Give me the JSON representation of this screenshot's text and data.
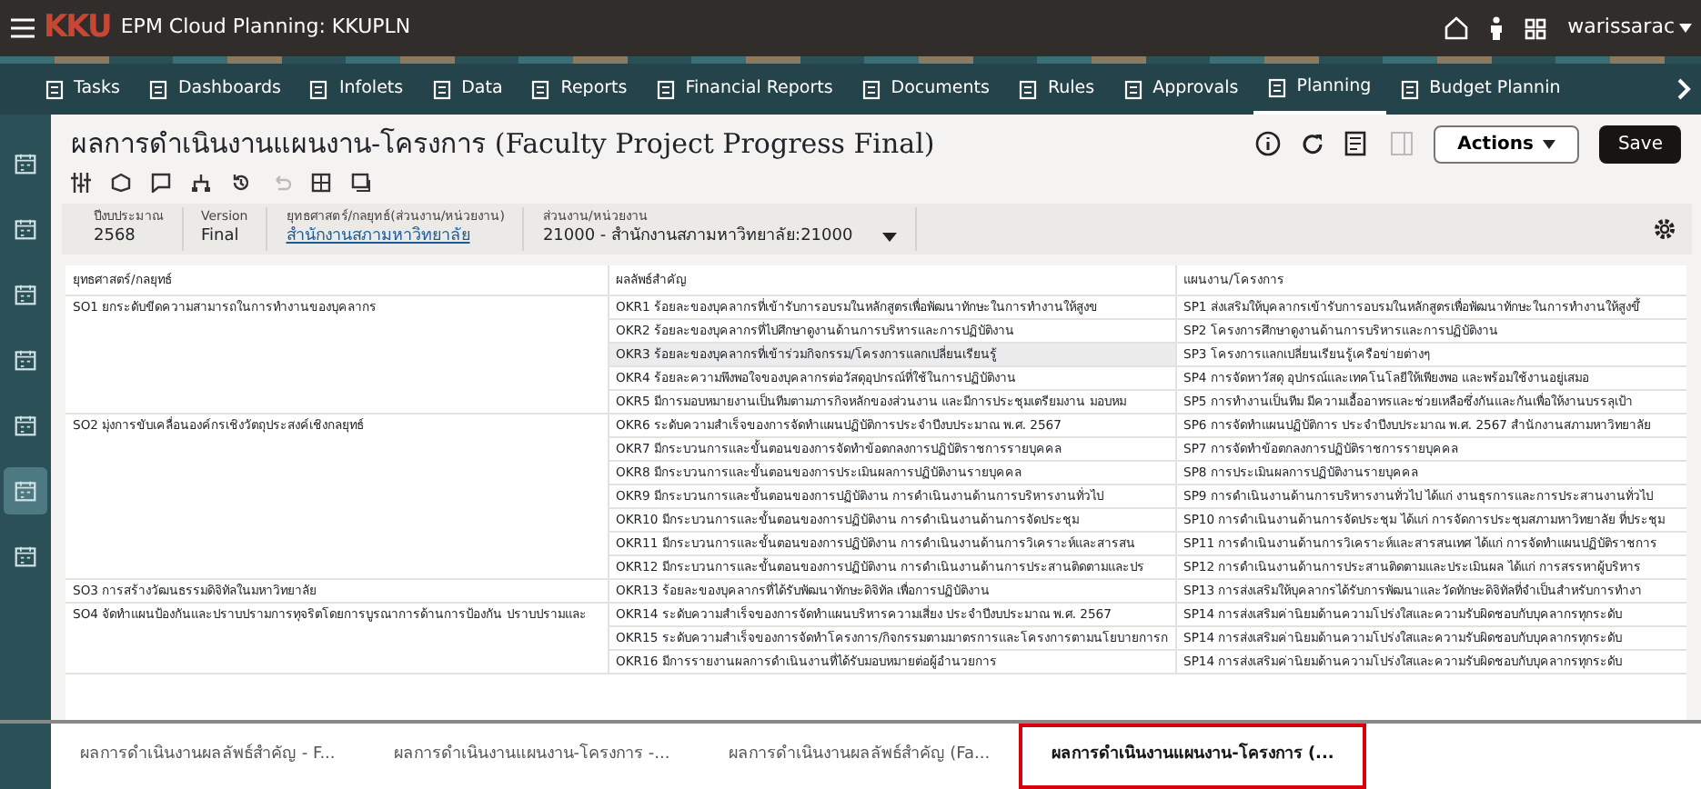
{
  "app_bar": {
    "title": "EPM Cloud Planning: KKUPLN",
    "logo": "KKU",
    "user": "warissarac"
  },
  "nav_tabs": [
    {
      "label": "Tasks",
      "selected": false
    },
    {
      "label": "Dashboards",
      "selected": false
    },
    {
      "label": "Infolets",
      "selected": false
    },
    {
      "label": "Data",
      "selected": false
    },
    {
      "label": "Reports",
      "selected": false
    },
    {
      "label": "Financial Reports",
      "selected": false
    },
    {
      "label": "Documents",
      "selected": false
    },
    {
      "label": "Rules",
      "selected": false
    },
    {
      "label": "Approvals",
      "selected": false
    },
    {
      "label": "Planning",
      "selected": true
    },
    {
      "label": "Budget Plannin",
      "selected": false
    }
  ],
  "side_rail": [
    {
      "selected": false
    },
    {
      "selected": false
    },
    {
      "selected": false
    },
    {
      "selected": false
    },
    {
      "selected": false
    },
    {
      "selected": true
    },
    {
      "selected": false
    }
  ],
  "page": {
    "title": "ผลการดำเนินงานแผนงาน-โครงการ (Faculty Project Progress Final)",
    "actions": "Actions",
    "save": "Save"
  },
  "pov": [
    {
      "kind": "text",
      "label": "ปีงบประมาณ",
      "value": "2568"
    },
    {
      "kind": "text",
      "label": "Version",
      "value": "Final"
    },
    {
      "kind": "link",
      "label": "ยุทธศาสตร์/กลยุทธ์(ส่วนงาน/หน่วยงาน)",
      "value": "สำนักงานสภามหาวิทยาลัย"
    },
    {
      "kind": "dropdown",
      "label": "ส่วนงาน/หน่วยงาน",
      "value": "21000 - สำนักงานสภามหาวิทยาลัย:21000"
    }
  ],
  "table": {
    "columns": [
      "ยุทธศาสตร์/กลยุทธ์",
      "ผลลัพธ์สำคัญ",
      "แผนงาน/โครงการ"
    ],
    "groups": [
      {
        "strategy": "SO1 ยกระดับขีดความสามารถในการทำงานของบุคลากร",
        "rows": [
          {
            "okr": "OKR1 ร้อยละของบุคลากรที่เข้ารับการอบรมในหลักสูตรเพื่อพัฒนาทักษะในการทำงานให้สูงข",
            "plan": "SP1 ส่งเสริมให้บุคลากรเข้ารับการอบรมในหลักสูตรเพื่อพัฒนาทักษะในการทำงานให้สูงขึ้",
            "highlighted": false
          },
          {
            "okr": "OKR2 ร้อยละของบุคลากรที่ไปศึกษาดูงานด้านการบริหารและการปฏิบัติงาน",
            "plan": "SP2 โครงการศึกษาดูงานด้านการบริหารและการปฏิบัติงาน",
            "highlighted": false
          },
          {
            "okr": "OKR3 ร้อยละของบุคลากรที่เข้าร่วมกิจกรรม/โครงการแลกเปลี่ยนเรียนรู้",
            "plan": "SP3 โครงการแลกเปลี่ยนเรียนรู้เครือข่ายต่างๆ",
            "highlighted": true
          },
          {
            "okr": "OKR4 ร้อยละความพึงพอใจของบุคลากรต่อวัสดุอุปกรณ์ที่ใช้ในการปฏิบัติงาน",
            "plan": "SP4 การจัดหาวัสดุ อุปกรณ์และเทคโนโลยีให้เพียงพอ และพร้อมใช้งานอยู่เสมอ",
            "highlighted": false
          },
          {
            "okr": "OKR5 มีการมอบหมายงานเป็นทีมตามภารกิจหลักของส่วนงาน และมีการประชุมเตรียมงาน มอบหม",
            "plan": "SP5 การทำงานเป็นทีม มีความเอื้ออาทรและช่วยเหลือซึ่งกันและกันเพื่อให้งานบรรลุเป้า",
            "highlighted": false
          }
        ]
      },
      {
        "strategy": "SO2 มุ่งการขับเคลื่อนองค์กรเชิงวัตถุประสงค์เชิงกลยุทธ์",
        "rows": [
          {
            "okr": "OKR6 ระดับความสำเร็จของการจัดทำแผนปฏิบัติการประจำปีงบประมาณ พ.ศ. 2567",
            "plan": "SP6 การจัดทำแผนปฏิบัติการ ประจำปีงบประมาณ พ.ศ. 2567 สำนักงานสภามหาวิทยาลัย",
            "highlighted": false
          },
          {
            "okr": "OKR7 มีกระบวนการและขั้นตอนของการจัดทำข้อตกลงการปฏิบัติราชการรายบุคคล",
            "plan": "SP7 การจัดทำข้อตกลงการปฏิบัติราชการรายบุคคล",
            "highlighted": false
          },
          {
            "okr": "OKR8 มีกระบวนการและขั้นตอนของการประเมินผลการปฏิบัติงานรายบุคคล",
            "plan": "SP8 การประเมินผลการปฏิบัติงานรายบุคคล",
            "highlighted": false
          },
          {
            "okr": "OKR9 มีกระบวนการและขั้นตอนของการปฏิบัติงาน การดำเนินงานด้านการบริหารงานทั่วไป",
            "plan": "SP9 การดำเนินงานด้านการบริหารงานทั่วไป ได้แก่ งานธุรการและการประสานงานทั่วไป",
            "highlighted": false
          },
          {
            "okr": "OKR10 มีกระบวนการและขั้นตอนของการปฏิบัติงาน การดำเนินงานด้านการจัดประชุม",
            "plan": "SP10 การดำเนินงานด้านการจัดประชุม ได้แก่ การจัดการประชุมสภามหาวิทยาลัย ที่ประชุม",
            "highlighted": false
          },
          {
            "okr": "OKR11 มีกระบวนการและขั้นตอนของการปฏิบัติงาน การดำเนินงานด้านการวิเคราะห์และสารสน",
            "plan": "SP11 การดำเนินงานด้านการวิเคราะห์และสารสนเทศ ได้แก่ การจัดทำแผนปฏิบัติราชการ",
            "highlighted": false
          },
          {
            "okr": "OKR12 มีกระบวนการและขั้นตอนของการปฏิบัติงาน การดำเนินงานด้านการประสานติดตามและปร",
            "plan": "SP12 การดำเนินงานด้านการประสานติดตามและประเมินผล ได้แก่ การสรรหาผู้บริหาร",
            "highlighted": false
          }
        ]
      },
      {
        "strategy": "SO3 การสร้างวัฒนธรรมดิจิทัลในมหาวิทยาลัย",
        "rows": [
          {
            "okr": "OKR13 ร้อยละของบุคลากรที่ได้รับพัฒนาทักษะดิจิทัล เพื่อการปฏิบัติงาน",
            "plan": "SP13 การส่งเสริมให้บุคลากรได้รับการพัฒนาและวัดทักษะดิจิทัลที่จำเป็นสำหรับการทำงา",
            "highlighted": false
          }
        ]
      },
      {
        "strategy": "SO4 จัดทำแผนป้องกันและปราบปรามการทุจริตโดยการบูรณาการด้านการป้องกัน ปราบปรามและ",
        "rows": [
          {
            "okr": "OKR14 ระดับความสำเร็จของการจัดทำแผนบริหารความเสี่ยง ประจำปีงบประมาณ พ.ศ. 2567",
            "plan": "SP14 การส่งเสริมค่านิยมด้านความโปร่งใสและความรับผิดชอบกับบุคลากรทุกระดับ",
            "highlighted": false
          },
          {
            "okr": "OKR15 ระดับความสำเร็จของการจัดทำโครงการ/กิจกรรมตามมาตรการและโครงการตามนโยบายการก",
            "plan": "SP14 การส่งเสริมค่านิยมด้านความโปร่งใสและความรับผิดชอบกับบุคลากรทุกระดับ",
            "highlighted": false
          },
          {
            "okr": "OKR16 มีการรายงานผลการดำเนินงานที่ได้รับมอบหมายต่อผู้อำนวยการ",
            "plan": "SP14 การส่งเสริมค่านิยมด้านความโปร่งใสและความรับผิดชอบกับบุคลากรทุกระดับ",
            "highlighted": false
          }
        ]
      }
    ]
  },
  "bottom_tabs": [
    {
      "label": "ผลการดำเนินงานผลลัพธ์สำคัญ - F...",
      "selected": false
    },
    {
      "label": "ผลการดำเนินงานแผนงาน-โครงการ -...",
      "selected": false
    },
    {
      "label": "ผลการดำเนินงานผลลัพธ์สำคัญ (Fa...",
      "selected": false
    },
    {
      "label": "ผลการดำเนินงานแผนงาน-โครงการ (...",
      "selected": true
    }
  ]
}
